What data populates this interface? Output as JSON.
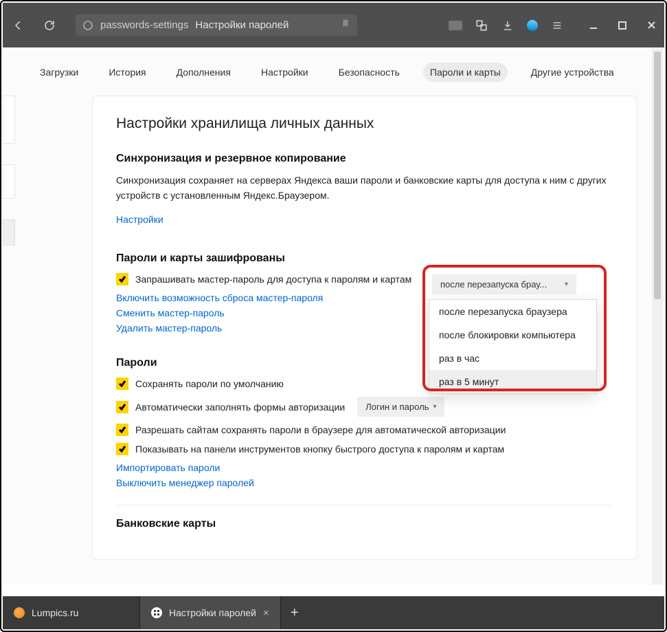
{
  "titlebar": {
    "url": "passwords-settings",
    "page_label": "Настройки паролей"
  },
  "tabs": [
    "Загрузки",
    "История",
    "Дополнения",
    "Настройки",
    "Безопасность",
    "Пароли и карты",
    "Другие устройства"
  ],
  "page": {
    "title": "Настройки хранилища личных данных",
    "sync": {
      "heading": "Синхронизация и резервное копирование",
      "desc": "Синхронизация сохраняет на серверах Яндекса ваши пароли и банковские карты для доступа к ним с других устройств с установленным Яндекс.Браузером.",
      "link": "Настройки"
    },
    "enc": {
      "heading": "Пароли и карты зашифрованы",
      "ask_label": "Запрашивать мастер-пароль для доступа к паролям и картам",
      "select_value": "после перезапуска брау...",
      "options": [
        "после перезапуска браузера",
        "после блокировки компьютера",
        "раз в час",
        "раз в 5 минут"
      ],
      "link_reset": "Включить возможность сброса мастер-пароля",
      "link_change": "Сменить мастер-пароль",
      "link_delete": "Удалить мастер-пароль"
    },
    "passwords": {
      "heading": "Пароли",
      "save_default": "Сохранять пароли по умолчанию",
      "autofill": "Автоматически заполнять формы авторизации",
      "autofill_select": "Логин и пароль",
      "allow_sites": "Разрешать сайтам сохранять пароли в браузере для автоматической авторизации",
      "show_toolbar": "Показывать на панели инструментов кнопку быстрого доступа к паролям и картам",
      "link_import": "Импортировать пароли",
      "link_disable": "Выключить менеджер паролей"
    },
    "cards": {
      "heading": "Банковские карты"
    }
  },
  "bottom_tabs": [
    {
      "label": "Lumpics.ru"
    },
    {
      "label": "Настройки паролей"
    }
  ]
}
